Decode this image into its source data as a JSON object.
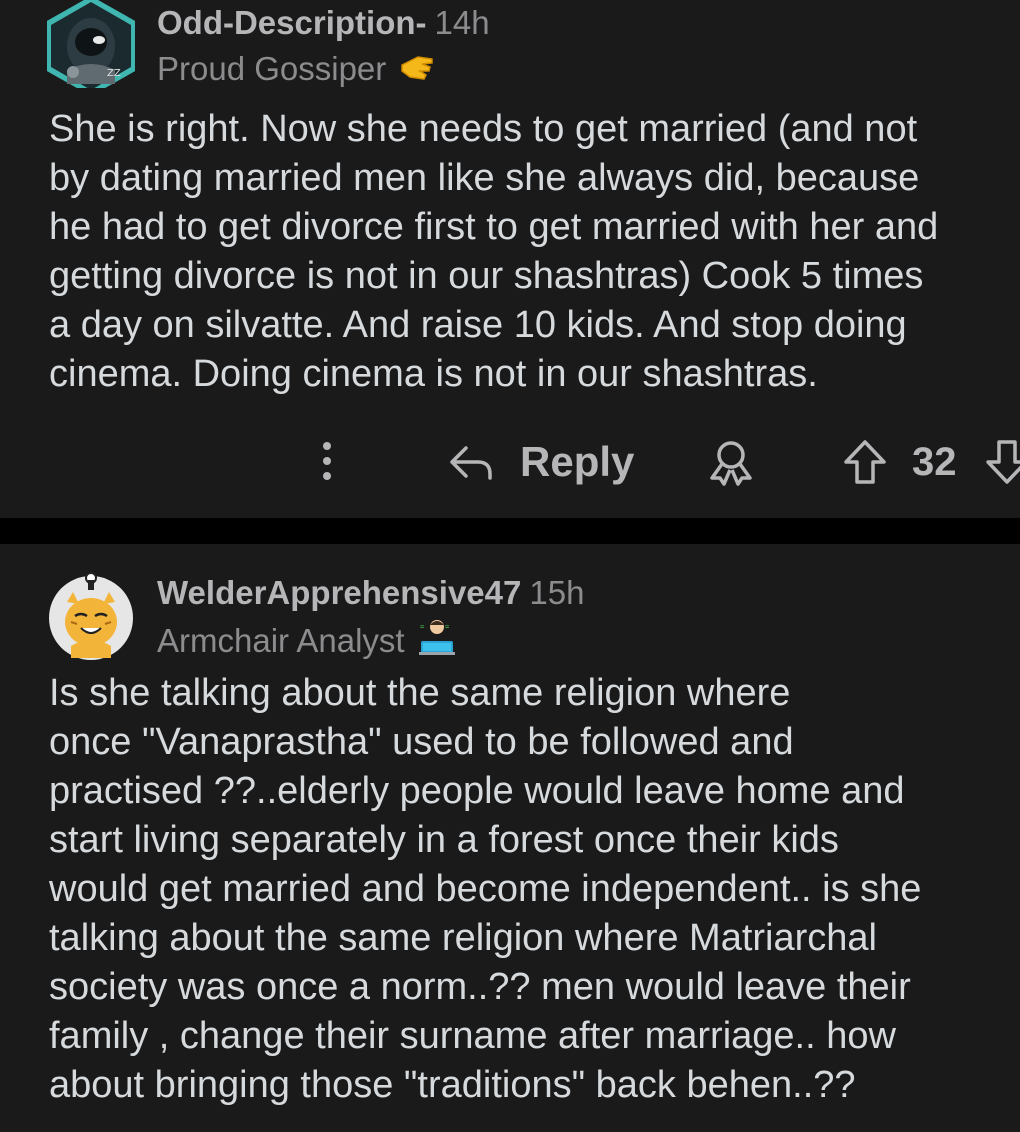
{
  "comments": [
    {
      "username": "Odd-Description-",
      "age": "14h",
      "flair": "Proud Gossiper",
      "flair_emoji": "pointing-hand-icon",
      "body_lines": [
        "She is right. Now she needs to get married (and not",
        "by dating married men like she always did, because",
        "he had to get divorce first to get married with her and",
        "getting divorce is not in our shashtras) Cook 5 times",
        "a day on silvatte. And raise 10 kids. And stop doing",
        "cinema. Doing cinema is not in our shashtras."
      ],
      "actions": {
        "reply_label": "Reply",
        "score": "32"
      }
    },
    {
      "username": "WelderApprehensive47",
      "age": "15h",
      "flair": "Armchair Analyst",
      "flair_emoji": "technologist-icon",
      "body_lines": [
        "Is she talking about the same religion where",
        "once \"Vanaprastha\" used to be followed and",
        "practised ??..elderly people would leave home and",
        "start living separately in a forest once their kids",
        "would get married and become independent.. is she",
        "talking about the same religion where Matriarchal",
        "society was once a norm..?? men would leave their",
        "family , change their surname after marriage.. how",
        "about bringing those \"traditions\" back behen..??"
      ]
    }
  ],
  "colors": {
    "background": "#000000",
    "card": "#1a1a1b",
    "text": "#d7dadc",
    "meta": "#8c8c8e",
    "username": "#b6b6b8"
  }
}
